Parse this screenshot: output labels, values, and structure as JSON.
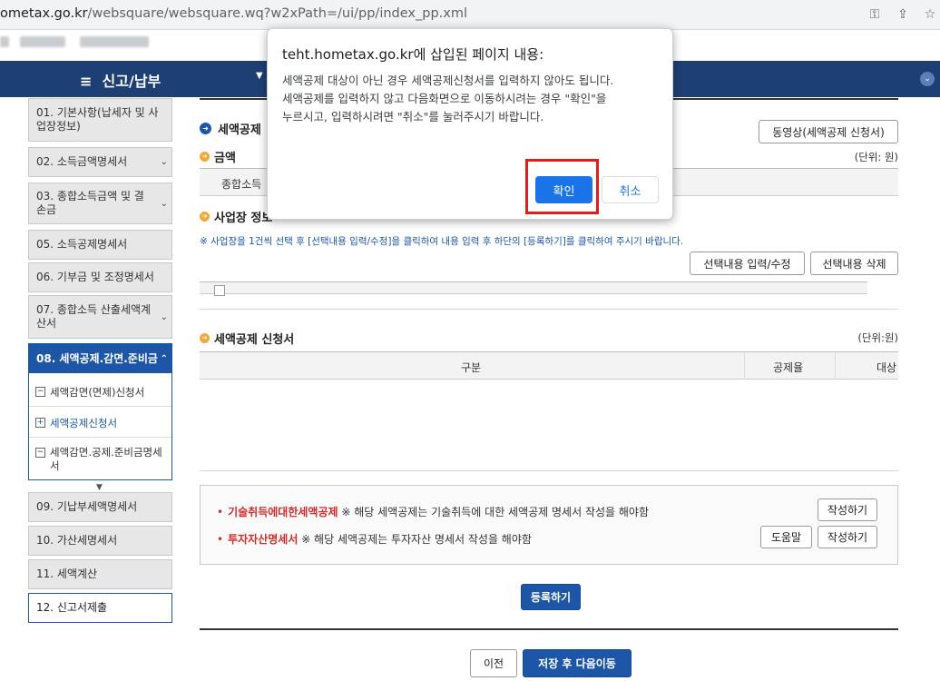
{
  "browser": {
    "url_host": "ometax.go.kr",
    "url_path": "/websquare/websquare.wq?w2xPath=/ui/pp/index_pp.xml"
  },
  "nav": {
    "menu_label": "신고/납부"
  },
  "sidebar": {
    "steps": [
      {
        "label": "01. 기본사항(납세자 및 사업장정보)"
      },
      {
        "label": "02. 소득금액명세서"
      },
      {
        "label": "03. 종합소득금액 및 결손금"
      },
      {
        "label": "05. 소득공제명세서"
      },
      {
        "label": "06. 기부금 및 조정명세서"
      },
      {
        "label": "07. 종합소득 산출세액계산서"
      },
      {
        "label": "08. 세액공제.감면.준비금"
      },
      {
        "label": "09. 기납부세액명세서"
      },
      {
        "label": "10. 가산세명세서"
      },
      {
        "label": "11. 세액계산"
      },
      {
        "label": "12. 신고서제출"
      }
    ],
    "subitems": [
      {
        "label": "세액감면(면제)신청서",
        "mark": "−"
      },
      {
        "label": "세액공제신청서",
        "mark": "+"
      },
      {
        "label": "세액감면.공제.준비금명세서",
        "mark": "−"
      }
    ]
  },
  "main": {
    "section_title": "세액공제",
    "video_button": "동영상(세액공제 신청서)",
    "amount_heading": "금액",
    "amount_unit": "(단위: 원)",
    "amount_col": "종합소득",
    "biz_heading": "사업장 정보",
    "notice": "※ 사업장을 1건씩 선택 후 [선택내용 입력/수정]을 클릭하여 내용 입력 후 하단의 [등록하기]를 클릭하여 주시기 바랍니다.",
    "edit_button": "선택내용 입력/수정",
    "delete_button": "선택내용 삭제",
    "credit_heading": "세액공제 신청서",
    "credit_unit": "(단위:원)",
    "credit_cols": [
      "구분",
      "공제율",
      "대상"
    ],
    "info": [
      {
        "red": "기술취득에대한세액공제",
        "text": "※ 해당 세액공제는 기술취득에 대한 세액공제 명세서 작성을 해야함",
        "write_button": "작성하기"
      },
      {
        "red": "투자자산명세서",
        "text": "※ 해당 세액공제는 투자자산 명세서 작성을 해야함",
        "help_button": "도움말",
        "write_button": "작성하기"
      }
    ],
    "register_button": "등록하기",
    "prev_button": "이전",
    "save_next_button": "저장 후 다음이동"
  },
  "dialog": {
    "title": "teht.hometax.go.kr에 삽입된 페이지 내용:",
    "lines": [
      "세액공제 대상이 아닌 경우 세액공제신청서를 입력하지 않아도 됩니다.",
      "세액공제를 입력하지 않고 다음화면으로 이동하시려는 경우 \"확인\"을",
      "누르시고, 입력하시려면 \"취소\"를 눌러주시기 바랍니다."
    ],
    "ok": "확인",
    "cancel": "취소"
  }
}
